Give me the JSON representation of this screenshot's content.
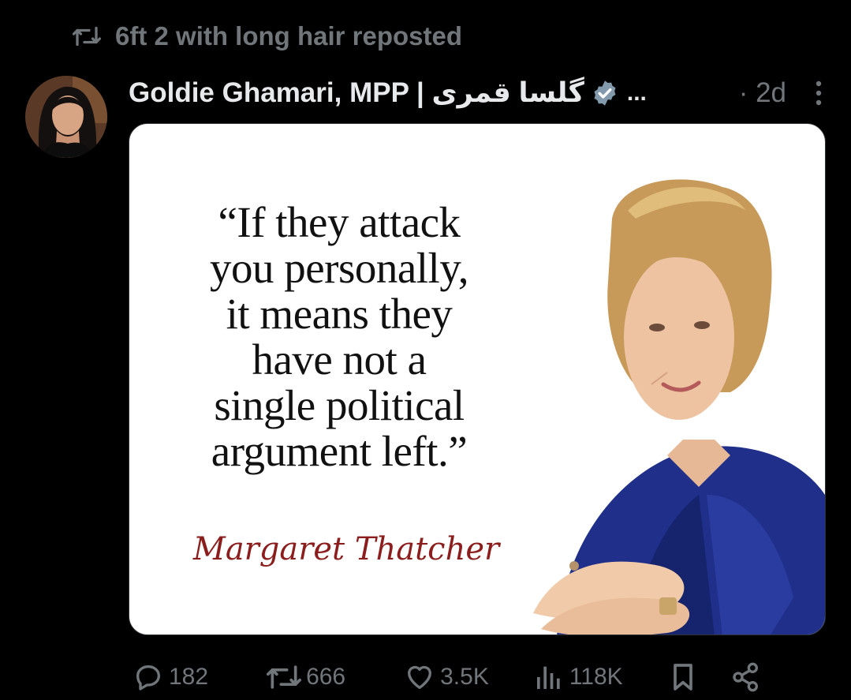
{
  "repost_banner": {
    "text": "6ft 2 with long hair reposted"
  },
  "post": {
    "author_name": "Goldie Ghamari, MPP | گلسا قمری",
    "truncation": "...",
    "timestamp": "· 2d",
    "image": {
      "quote_lines": [
        "“If they attack",
        "you personally,",
        "it means they",
        "have not a",
        "single political",
        "argument left.”"
      ],
      "attribution": "Margaret Thatcher"
    },
    "actions": {
      "replies": "182",
      "reposts": "666",
      "likes": "3.5K",
      "views": "118K"
    }
  },
  "colors": {
    "background": "#000000",
    "text_primary": "#e7e9ea",
    "text_secondary": "#71767b",
    "attribution": "#8c1d1d"
  }
}
